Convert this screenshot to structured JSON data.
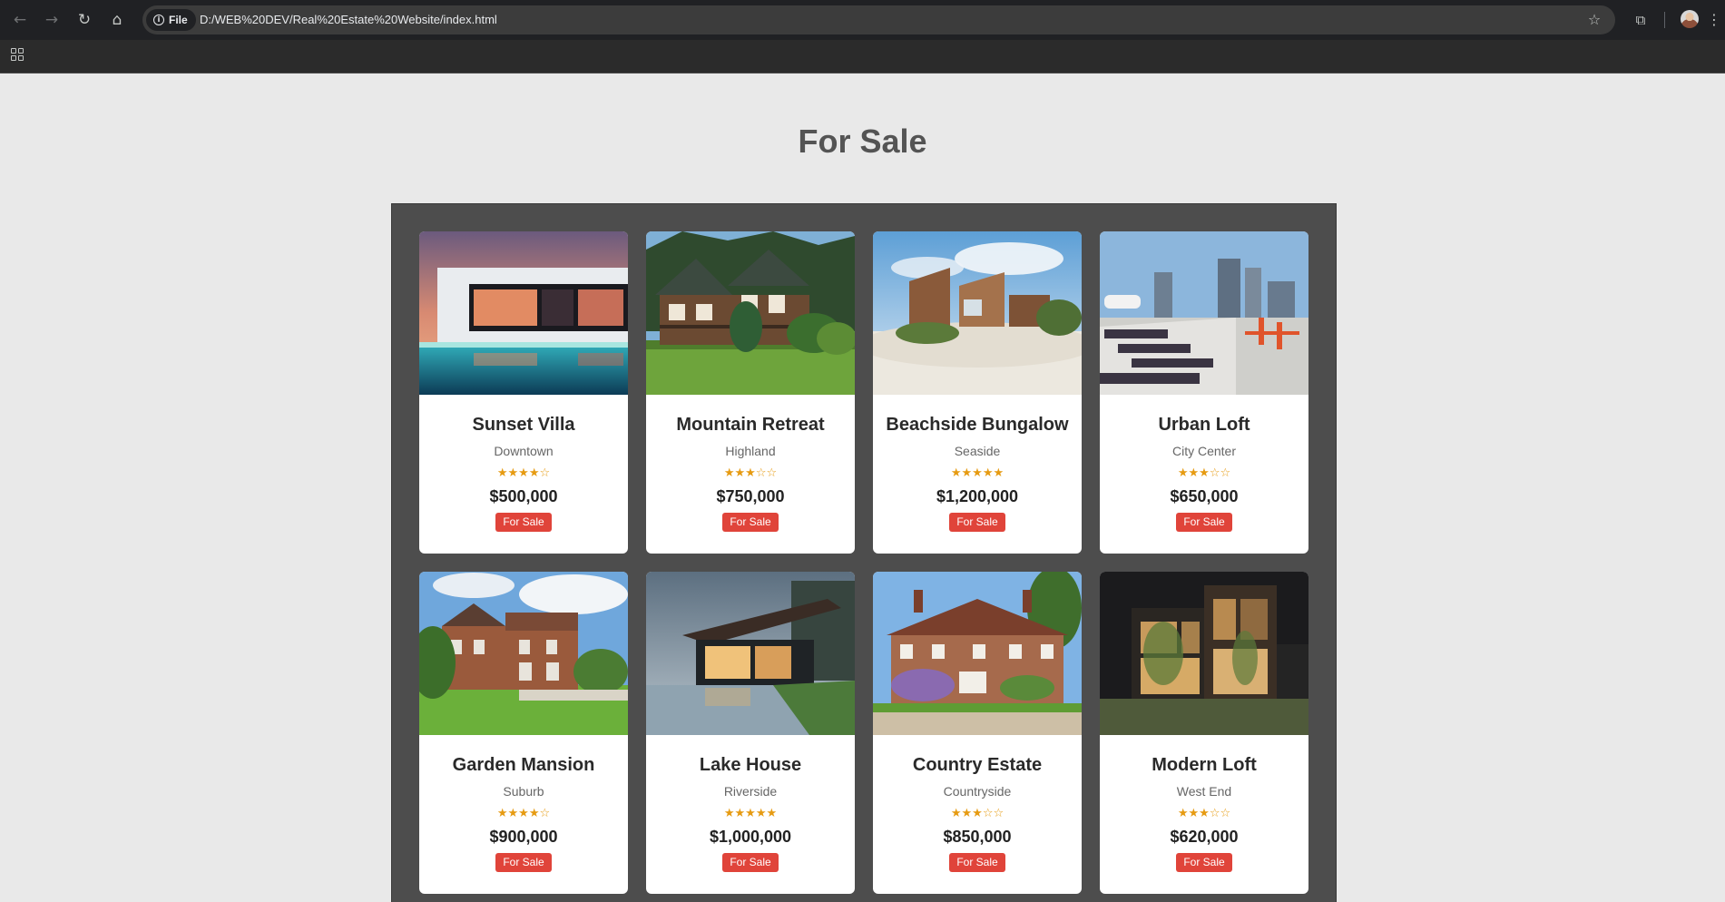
{
  "browser": {
    "site_chip": "File",
    "url": "D:/WEB%20DEV/Real%20Estate%20Website/index.html",
    "icons": [
      "back-arrow-icon",
      "forward-arrow-icon",
      "reload-icon",
      "home-icon",
      "info-icon",
      "bookmark-star-icon",
      "extensions-icon",
      "profile-avatar",
      "menu-dots-icon",
      "apps-grid-icon"
    ]
  },
  "page": {
    "title": "For Sale"
  },
  "colors": {
    "background": "#e9e9e9",
    "panel": "#4d4d4d",
    "badge": "#e0443a",
    "stars": "#e69b12",
    "title": "#545454"
  },
  "listings": [
    {
      "name": "Sunset Villa",
      "location": "Downtown",
      "rating_text": "★★★★☆",
      "rating": 4,
      "price": "$500,000",
      "badge": "For Sale"
    },
    {
      "name": "Mountain Retreat",
      "location": "Highland",
      "rating_text": "★★★☆☆",
      "rating": 3,
      "price": "$750,000",
      "badge": "For Sale"
    },
    {
      "name": "Beachside Bungalow",
      "location": "Seaside",
      "rating_text": "★★★★★",
      "rating": 5,
      "price": "$1,200,000",
      "badge": "For Sale"
    },
    {
      "name": "Urban Loft",
      "location": "City Center",
      "rating_text": "★★★☆☆",
      "rating": 3,
      "price": "$650,000",
      "badge": "For Sale"
    },
    {
      "name": "Garden Mansion",
      "location": "Suburb",
      "rating_text": "★★★★☆",
      "rating": 4,
      "price": "$900,000",
      "badge": "For Sale"
    },
    {
      "name": "Lake House",
      "location": "Riverside",
      "rating_text": "★★★★★",
      "rating": 5,
      "price": "$1,000,000",
      "badge": "For Sale"
    },
    {
      "name": "Country Estate",
      "location": "Countryside",
      "rating_text": "★★★☆☆",
      "rating": 3,
      "price": "$850,000",
      "badge": "For Sale"
    },
    {
      "name": "Modern Loft",
      "location": "West End",
      "rating_text": "★★★☆☆",
      "rating": 3,
      "price": "$620,000",
      "badge": "For Sale"
    }
  ]
}
